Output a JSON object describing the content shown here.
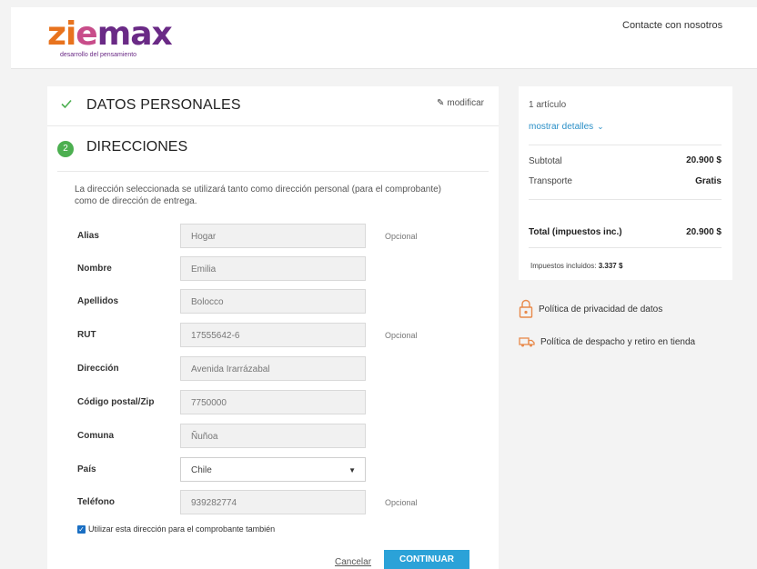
{
  "header": {
    "logo_text": "ziemax",
    "logo_tagline": "desarrollo del pensamiento",
    "contact_link": "Contacte con nosotros"
  },
  "checkout": {
    "personal_section_title": "DATOS PERSONALES",
    "modify_link": "modificar",
    "address_step_number": "2",
    "address_section_title": "DIRECCIONES",
    "intro_text": "La dirección seleccionada se utilizará tanto como dirección personal (para el comprobante) como de dirección de entrega.",
    "optional_label": "Opcional",
    "fields": {
      "alias": {
        "label": "Alias",
        "value": "Hogar"
      },
      "nombre": {
        "label": "Nombre",
        "value": "Emilia"
      },
      "apellidos": {
        "label": "Apellidos",
        "value": "Bolocco"
      },
      "rut": {
        "label": "RUT",
        "value": "17555642-6"
      },
      "direccion": {
        "label": "Dirección",
        "value": "Avenida Irarrázabal"
      },
      "codigo_postal": {
        "label": "Código postal/Zip",
        "value": "7750000"
      },
      "comuna": {
        "label": "Comuna",
        "value": "Ñuñoa"
      },
      "pais": {
        "label": "País",
        "value": "Chile"
      },
      "telefono": {
        "label": "Teléfono",
        "value": "939282774"
      }
    },
    "use_for_invoice_label": "Utilizar esta dirección para el comprobante también",
    "use_for_invoice_checked": true,
    "cancel_label": "Cancelar",
    "continue_label": "CONTINUAR"
  },
  "summary": {
    "item_count": "1 artículo",
    "show_details": "mostrar detalles",
    "subtotal_label": "Subtotal",
    "subtotal_value": "20.900 $",
    "shipping_label": "Transporte",
    "shipping_value": "Gratis",
    "total_label": "Total (impuestos inc.)",
    "total_value": "20.900 $",
    "tax_label": "Impuestos incluidos:",
    "tax_value": "3.337 $"
  },
  "policies": {
    "privacy": "Política de privacidad de datos",
    "shipping": "Política de despacho y retiro en tienda"
  },
  "colors": {
    "brand_orange": "#e8731e",
    "brand_purple": "#6a2a86",
    "step_green": "#4caf50",
    "button_blue": "#2ba2d8",
    "link_blue": "#2a8fc7",
    "policy_icon_orange": "#e8894a"
  }
}
